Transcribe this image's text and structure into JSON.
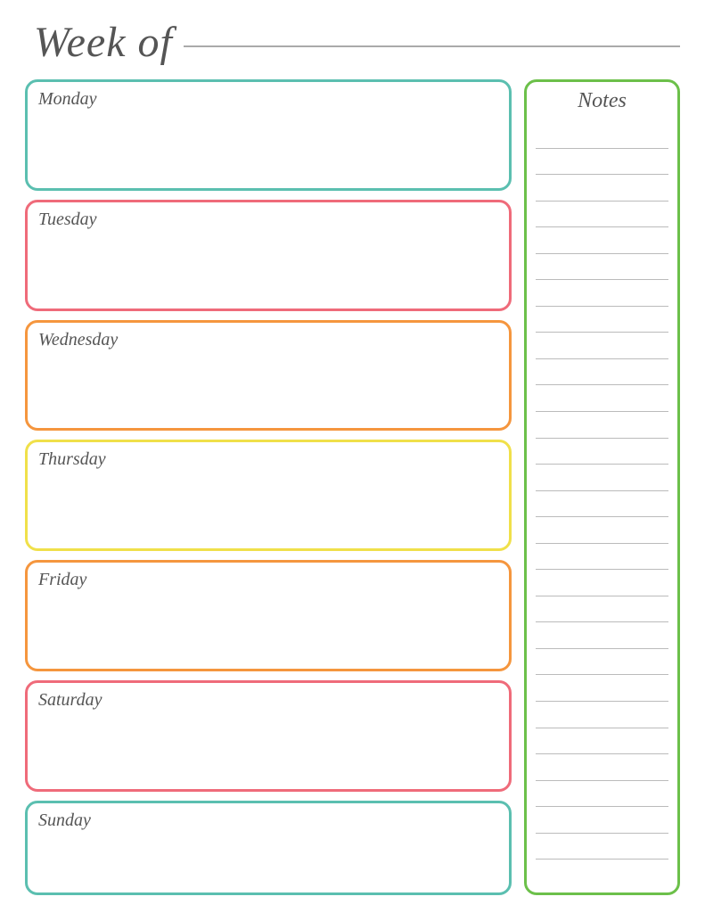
{
  "header": {
    "title": "Week of",
    "line_placeholder": ""
  },
  "days": [
    {
      "id": "monday",
      "label": "Monday",
      "color_class": "monday"
    },
    {
      "id": "tuesday",
      "label": "Tuesday",
      "color_class": "tuesday"
    },
    {
      "id": "wednesday",
      "label": "Wednesday",
      "color_class": "wednesday"
    },
    {
      "id": "thursday",
      "label": "Thursday",
      "color_class": "thursday"
    },
    {
      "id": "friday",
      "label": "Friday",
      "color_class": "friday"
    },
    {
      "id": "saturday",
      "label": "Saturday",
      "color_class": "saturday"
    },
    {
      "id": "sunday",
      "label": "Sunday",
      "color_class": "sunday"
    }
  ],
  "notes": {
    "title": "Notes",
    "line_count": 28
  }
}
